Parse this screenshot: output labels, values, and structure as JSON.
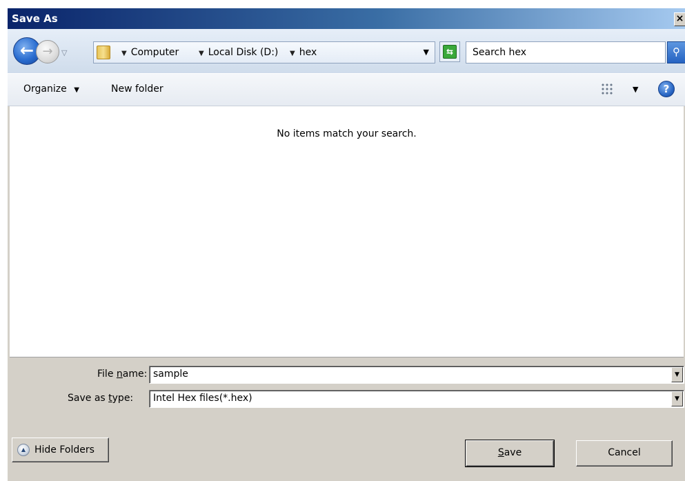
{
  "window": {
    "title": "Save As",
    "close_label": "×"
  },
  "nav": {
    "breadcrumbs": [
      "Computer",
      "Local Disk (D:)",
      "hex"
    ],
    "search_placeholder": "Search hex"
  },
  "toolbar": {
    "organize_label": "Organize",
    "new_folder_label": "New folder",
    "help_label": "?"
  },
  "content": {
    "empty_message": "No items match your search."
  },
  "form": {
    "file_name_label_pre": "File ",
    "file_name_label_u": "n",
    "file_name_label_post": "ame:",
    "file_name_value": "sample",
    "save_type_label_pre": "Save as ",
    "save_type_label_u": "t",
    "save_type_label_post": "ype:",
    "save_type_value": "Intel Hex files(*.hex)"
  },
  "buttons": {
    "save_u": "S",
    "save_rest": "ave",
    "cancel_label": "Cancel",
    "hide_folders_label": "Hide Folders"
  }
}
